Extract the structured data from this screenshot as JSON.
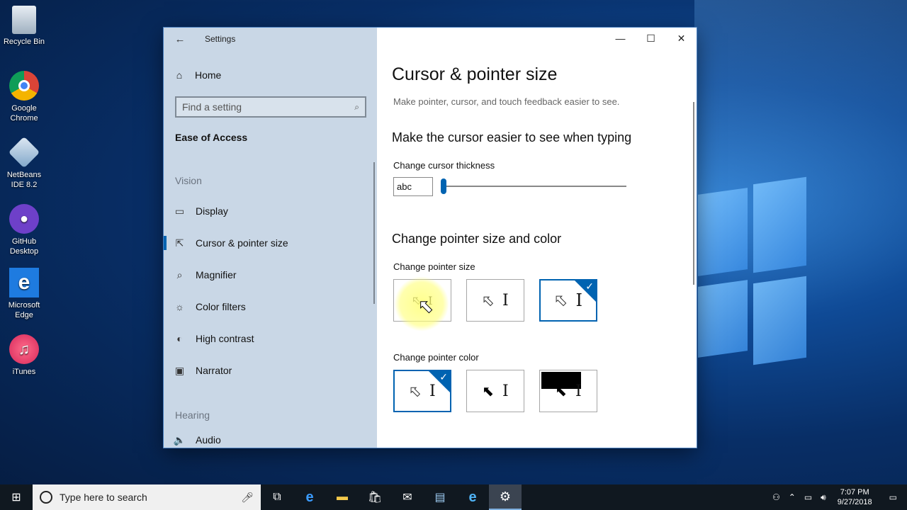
{
  "desktop": {
    "icons": [
      {
        "label": "Recycle Bin",
        "icon": "recycle-bin-icon"
      },
      {
        "label": "Google Chrome",
        "icon": "chrome-icon"
      },
      {
        "label": "NetBeans IDE 8.2",
        "icon": "netbeans-icon"
      },
      {
        "label": "GitHub Desktop",
        "icon": "github-icon"
      },
      {
        "label": "Microsoft Edge",
        "icon": "edge-icon"
      },
      {
        "label": "iTunes",
        "icon": "itunes-icon"
      }
    ]
  },
  "window": {
    "title": "Settings",
    "controls": {
      "minimize": "—",
      "maximize": "☐",
      "close": "✕"
    }
  },
  "sidebar": {
    "home": "Home",
    "search_placeholder": "Find a setting",
    "section_title": "Ease of Access",
    "vision_label": "Vision",
    "items": [
      {
        "label": "Display",
        "icon": "display-icon"
      },
      {
        "label": "Cursor & pointer size",
        "icon": "cursor-icon"
      },
      {
        "label": "Magnifier",
        "icon": "magnifier-icon"
      },
      {
        "label": "Color filters",
        "icon": "color-filters-icon"
      },
      {
        "label": "High contrast",
        "icon": "high-contrast-icon"
      },
      {
        "label": "Narrator",
        "icon": "narrator-icon"
      }
    ],
    "hearing_label": "Hearing",
    "audio_label": "Audio"
  },
  "content": {
    "title": "Cursor & pointer size",
    "subtitle": "Make pointer, cursor, and touch feedback easier to see.",
    "cursor_section": "Make the cursor easier to see when typing",
    "thickness_label": "Change cursor thickness",
    "thickness_preview": "abc",
    "thickness_value": 1,
    "pointer_section": "Change pointer size and color",
    "size_label": "Change pointer size",
    "size_selected_index": 2,
    "color_label": "Change pointer color",
    "color_selected_index": 0
  },
  "taskbar": {
    "search_placeholder": "Type here to search",
    "time": "7:07 PM",
    "date": "9/27/2018"
  }
}
